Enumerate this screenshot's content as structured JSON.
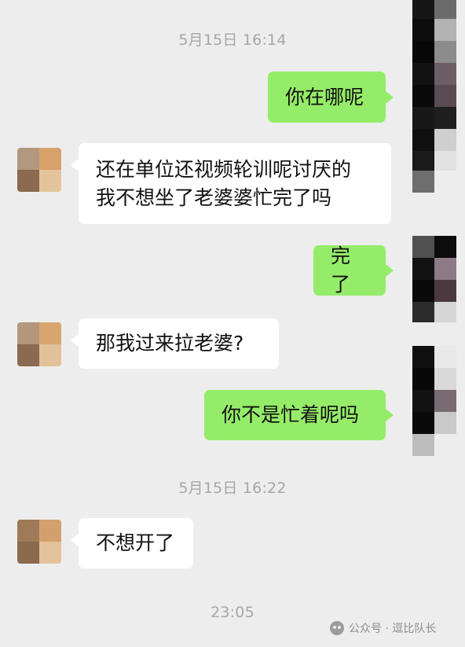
{
  "conversation": {
    "timestamps": [
      "5月15日 16:14",
      "5月15日 16:22",
      "23:05"
    ],
    "messages": [
      {
        "sender": "me",
        "text": "你在哪呢"
      },
      {
        "sender": "contact",
        "lines": [
          "还在单位还视频轮训呢讨厌的",
          "我不想坐了老婆婆忙完了吗"
        ]
      },
      {
        "sender": "me",
        "text": "完了"
      },
      {
        "sender": "contact",
        "text": "那我过来拉老婆?"
      },
      {
        "sender": "me",
        "text": "你不是忙着呢吗"
      },
      {
        "sender": "contact",
        "text": "不想开了"
      }
    ]
  },
  "watermark": {
    "label": "公众号 · 逗比队长",
    "icon": "wechat-icon"
  },
  "colors": {
    "background": "#ededed",
    "outgoing_bubble": "#95ec69",
    "incoming_bubble": "#ffffff",
    "timestamp_text": "#a6a6a6"
  }
}
